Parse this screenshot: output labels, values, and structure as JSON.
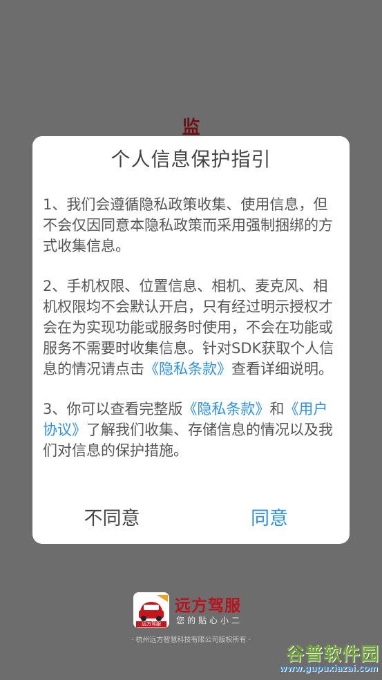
{
  "background": {
    "heading": "监"
  },
  "dialog": {
    "title": "个人信息保护指引",
    "p1": "1、我们会遵循隐私政策收集、使用信息，但不会仅因同意本隐私政策而采用强制捆绑的方式收集信息。",
    "p2_before": "2、手机权限、位置信息、相机、麦克风、相机权限均不会默认开启，只有经过明示授权才会在为实现功能或服务时使用，不会在功能或服务不需要时收集信息。针对SDK获取个人信息的情况请点击",
    "p2_link": "《隐私条款》",
    "p2_after": "查看详细说明。",
    "p3_before": "3、你可以查看完整版",
    "p3_link1": "《隐私条款》",
    "p3_middle": "和",
    "p3_link2": "《用户协议》",
    "p3_after": "了解我们收集、存储信息的情况以及我们对信息的保护措施。",
    "disagree_label": "不同意",
    "agree_label": "同意"
  },
  "brand": {
    "name": "远方驾服",
    "slogan": "您的贴心小二",
    "logo_badge": "远方驾服",
    "copyright": "· 杭州远方智慧科技有限公司版权所有 ·"
  },
  "watermark": {
    "name": "谷普软件园",
    "url": "www.gupuxiazai.com"
  },
  "colors": {
    "overlay": "#6d6d6d",
    "link": "#2e8fe3",
    "brand_red": "#b8131c"
  }
}
